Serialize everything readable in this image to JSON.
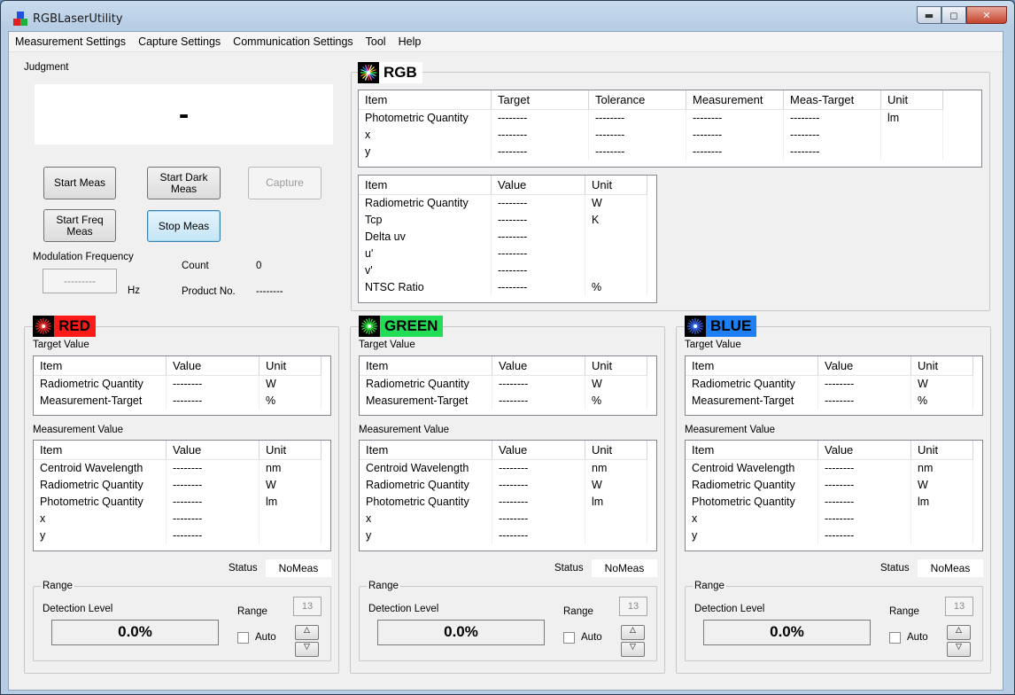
{
  "window": {
    "title": "RGBLaserUtility",
    "min": "▬",
    "max": "◻",
    "close": "✕"
  },
  "menu": [
    "Measurement Settings",
    "Capture Settings",
    "Communication Settings",
    "Tool",
    "Help"
  ],
  "judgment": {
    "label": "Judgment",
    "value": "-"
  },
  "buttons": {
    "start_meas": "Start Meas",
    "start_dark_meas": "Start Dark Meas",
    "capture": "Capture",
    "start_freq_meas": "Start Freq Meas",
    "stop_meas": "Stop Meas"
  },
  "modulation": {
    "label": "Modulation Frequency",
    "value": "---------",
    "unit": "Hz"
  },
  "count": {
    "label": "Count",
    "value": "0"
  },
  "product": {
    "label": "Product No.",
    "value": "--------"
  },
  "rgb": {
    "title": "RGB",
    "table1": {
      "headers": [
        "Item",
        "Target",
        "Tolerance",
        "Measurement",
        "Meas-Target",
        "Unit"
      ],
      "rows": [
        [
          "Photometric Quantity",
          "--------",
          "--------",
          "--------",
          "--------",
          "lm"
        ],
        [
          "x",
          "--------",
          "--------",
          "--------",
          "--------",
          ""
        ],
        [
          "y",
          "--------",
          "--------",
          "--------",
          "--------",
          ""
        ]
      ]
    },
    "table2": {
      "headers": [
        "Item",
        "Value",
        "Unit"
      ],
      "rows": [
        [
          "Radiometric Quantity",
          "--------",
          "W"
        ],
        [
          "Tcp",
          "--------",
          "K"
        ],
        [
          "Delta uv",
          "--------",
          ""
        ],
        [
          "u'",
          "--------",
          ""
        ],
        [
          "v'",
          "--------",
          ""
        ],
        [
          "NTSC Ratio",
          "--------",
          "%"
        ]
      ]
    }
  },
  "channels": [
    {
      "title": "RED",
      "color": "#ff1a1a",
      "star_color": "#ff3030",
      "target_label": "Target Value",
      "target_headers": [
        "Item",
        "Value",
        "Unit"
      ],
      "target_rows": [
        [
          "Radiometric Quantity",
          "--------",
          "W"
        ],
        [
          "Measurement-Target",
          "--------",
          "%"
        ]
      ],
      "meas_label": "Measurement Value",
      "meas_headers": [
        "Item",
        "Value",
        "Unit"
      ],
      "meas_rows": [
        [
          "Centroid Wavelength",
          "--------",
          "nm"
        ],
        [
          "Radiometric Quantity",
          "--------",
          "W"
        ],
        [
          "Photometric Quantity",
          "--------",
          "lm"
        ],
        [
          "x",
          "--------",
          ""
        ],
        [
          "y",
          "--------",
          ""
        ]
      ],
      "status_label": "Status",
      "status_value": "NoMeas",
      "range_label": "Range",
      "detection_label": "Detection Level",
      "detection_value": "0.0%",
      "range_sub_label": "Range",
      "range_value": "13",
      "auto_label": "Auto"
    },
    {
      "title": "GREEN",
      "color": "#22dd55",
      "star_color": "#33ee44",
      "target_label": "Target Value",
      "target_headers": [
        "Item",
        "Value",
        "Unit"
      ],
      "target_rows": [
        [
          "Radiometric Quantity",
          "--------",
          "W"
        ],
        [
          "Measurement-Target",
          "--------",
          "%"
        ]
      ],
      "meas_label": "Measurement Value",
      "meas_headers": [
        "Item",
        "Value",
        "Unit"
      ],
      "meas_rows": [
        [
          "Centroid Wavelength",
          "--------",
          "nm"
        ],
        [
          "Radiometric Quantity",
          "--------",
          "W"
        ],
        [
          "Photometric Quantity",
          "--------",
          "lm"
        ],
        [
          "x",
          "--------",
          ""
        ],
        [
          "y",
          "--------",
          ""
        ]
      ],
      "status_label": "Status",
      "status_value": "NoMeas",
      "range_label": "Range",
      "detection_label": "Detection Level",
      "detection_value": "0.0%",
      "range_sub_label": "Range",
      "range_value": "13",
      "auto_label": "Auto"
    },
    {
      "title": "BLUE",
      "color": "#1e7ff5",
      "star_color": "#3a6dff",
      "target_label": "Target Value",
      "target_headers": [
        "Item",
        "Value",
        "Unit"
      ],
      "target_rows": [
        [
          "Radiometric Quantity",
          "--------",
          "W"
        ],
        [
          "Measurement-Target",
          "--------",
          "%"
        ]
      ],
      "meas_label": "Measurement Value",
      "meas_headers": [
        "Item",
        "Value",
        "Unit"
      ],
      "meas_rows": [
        [
          "Centroid Wavelength",
          "--------",
          "nm"
        ],
        [
          "Radiometric Quantity",
          "--------",
          "W"
        ],
        [
          "Photometric Quantity",
          "--------",
          "lm"
        ],
        [
          "x",
          "--------",
          ""
        ],
        [
          "y",
          "--------",
          ""
        ]
      ],
      "status_label": "Status",
      "status_value": "NoMeas",
      "range_label": "Range",
      "detection_label": "Detection Level",
      "detection_value": "0.0%",
      "range_sub_label": "Range",
      "range_value": "13",
      "auto_label": "Auto"
    }
  ]
}
